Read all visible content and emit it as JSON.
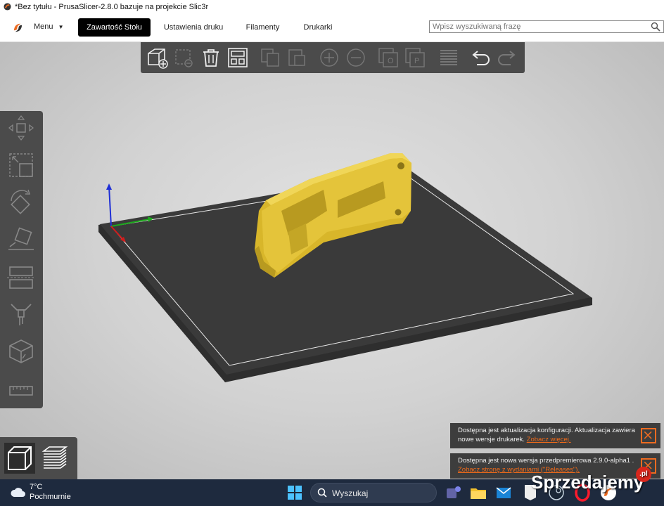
{
  "window": {
    "title": "*Bez tytułu - PrusaSlicer-2.8.0 bazuje na projekcie Slic3r"
  },
  "menubar": {
    "menu_label": "Menu",
    "tabs": [
      {
        "label": "Zawartość Stołu",
        "active": true
      },
      {
        "label": "Ustawienia druku",
        "active": false
      },
      {
        "label": "Filamenty",
        "active": false
      },
      {
        "label": "Drukarki",
        "active": false
      }
    ],
    "search_placeholder": "Wpisz wyszukiwaną frazę"
  },
  "top_toolbar": {
    "icons": [
      "add-object-icon",
      "delete-icon",
      "delete-all-icon",
      "arrange-icon",
      "copy-icon",
      "paste-icon",
      "add-instance-icon",
      "remove-instance-icon",
      "split-objects-icon",
      "split-parts-icon",
      "variable-layer-height-icon",
      "undo-icon",
      "redo-icon"
    ]
  },
  "left_toolbar": {
    "icons": [
      "move-icon",
      "scale-icon",
      "rotate-icon",
      "place-on-face-icon",
      "cut-icon",
      "supports-paint-icon",
      "seam-paint-icon",
      "measure-icon"
    ]
  },
  "view_switch": {
    "icons": [
      "3d-view-icon",
      "preview-layers-icon"
    ],
    "active": "3d-view-icon"
  },
  "notifications": [
    {
      "text": "Dostępna jest aktualizacja konfiguracji. Aktualizacja zawiera nowe wersje drukarek.",
      "link": "Zobacz więcej."
    },
    {
      "text": "Dostępna jest nowa wersja przedpremierowa 2.9.0-alpha1 .",
      "link": "Zobacz stronę z wydaniami (\"Releases\")."
    }
  ],
  "taskbar": {
    "weather_temp": "7°C",
    "weather_desc": "Pochmurnie",
    "search_label": "Wyszukaj",
    "apps": [
      "start-icon",
      "search-icon",
      "teams-icon",
      "file-explorer-icon",
      "mail-icon",
      "epic-games-icon",
      "steam-icon",
      "opera-icon",
      "prusaslicer-icon"
    ]
  },
  "watermark": {
    "text": "Sprzedajemy",
    "suffix": ".pl"
  },
  "colors": {
    "accent": "#ed6b21",
    "model": "#e2c232",
    "bed": "#3b3b3b",
    "toolbar": "#4b4b4b"
  }
}
